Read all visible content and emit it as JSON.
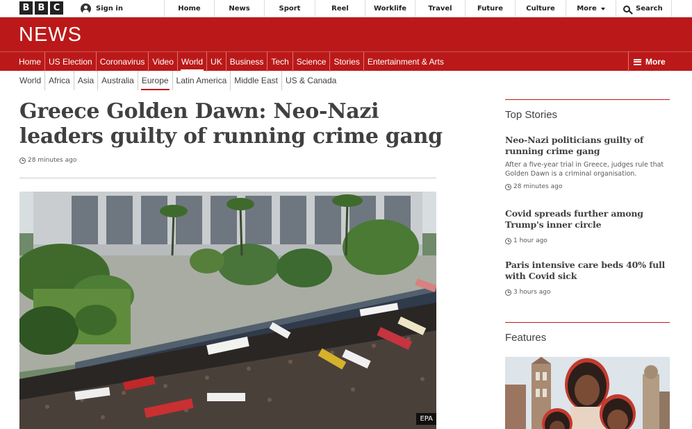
{
  "brand": {
    "logo_letters": [
      "B",
      "B",
      "C"
    ],
    "signin_label": "Sign in",
    "section_title": "NEWS",
    "accent_color": "#bb1919"
  },
  "top_nav": {
    "items": [
      "Home",
      "News",
      "Sport",
      "Reel",
      "Worklife",
      "Travel",
      "Future",
      "Culture"
    ],
    "more_label": "More",
    "search_label": "Search"
  },
  "main_nav": {
    "items": [
      "Home",
      "US Election",
      "Coronavirus",
      "Video",
      "World",
      "UK",
      "Business",
      "Tech",
      "Science",
      "Stories",
      "Entertainment & Arts"
    ],
    "active": "World",
    "more_label": "More"
  },
  "sub_nav": {
    "items": [
      "World",
      "Africa",
      "Asia",
      "Australia",
      "Europe",
      "Latin America",
      "Middle East",
      "US & Canada"
    ],
    "active": "Europe"
  },
  "article": {
    "headline": "Greece Golden Dawn: Neo-Nazi leaders guilty of running crime gang",
    "timestamp": "28 minutes ago",
    "image_credit": "EPA"
  },
  "top_stories": {
    "heading": "Top Stories",
    "items": [
      {
        "title": "Neo-Nazi politicians guilty of running crime gang",
        "summary": "After a five-year trial in Greece, judges rule that Golden Dawn is a criminal organisation.",
        "time": "28 minutes ago"
      },
      {
        "title": "Covid spreads further among Trump's inner circle",
        "time": "1 hour ago"
      },
      {
        "title": "Paris intensive care beds 40% full with Covid sick",
        "time": "3 hours ago"
      }
    ]
  },
  "features": {
    "heading": "Features"
  }
}
